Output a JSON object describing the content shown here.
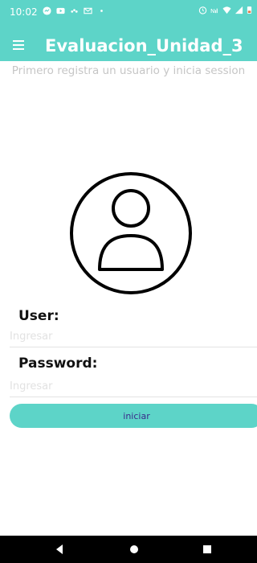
{
  "status_bar": {
    "time": "10:02",
    "left_icons": [
      "messenger-icon",
      "youtube-icon",
      "dots-icon",
      "gmail-icon",
      "dot-icon"
    ],
    "right_icons": [
      "alarm-icon",
      "signal-strength-icon",
      "wifi-icon",
      "cellular-icon",
      "battery-icon"
    ]
  },
  "app_bar": {
    "title": "Evaluacion_Unidad_3",
    "background": "#5dd4c8",
    "menu_icon": "hamburger-menu-icon"
  },
  "main": {
    "subtitle": "Primero registra un usuario y inicia session",
    "avatar_icon": "user-avatar-icon",
    "user_label": "User:",
    "user_placeholder": "Ingresar",
    "password_label": "Password:",
    "password_placeholder": "Ingresar",
    "login_button": "iniciar",
    "accent": "#5dd4c8"
  },
  "nav_bar": {
    "icons": [
      "back-icon",
      "home-icon",
      "recent-apps-icon"
    ]
  }
}
